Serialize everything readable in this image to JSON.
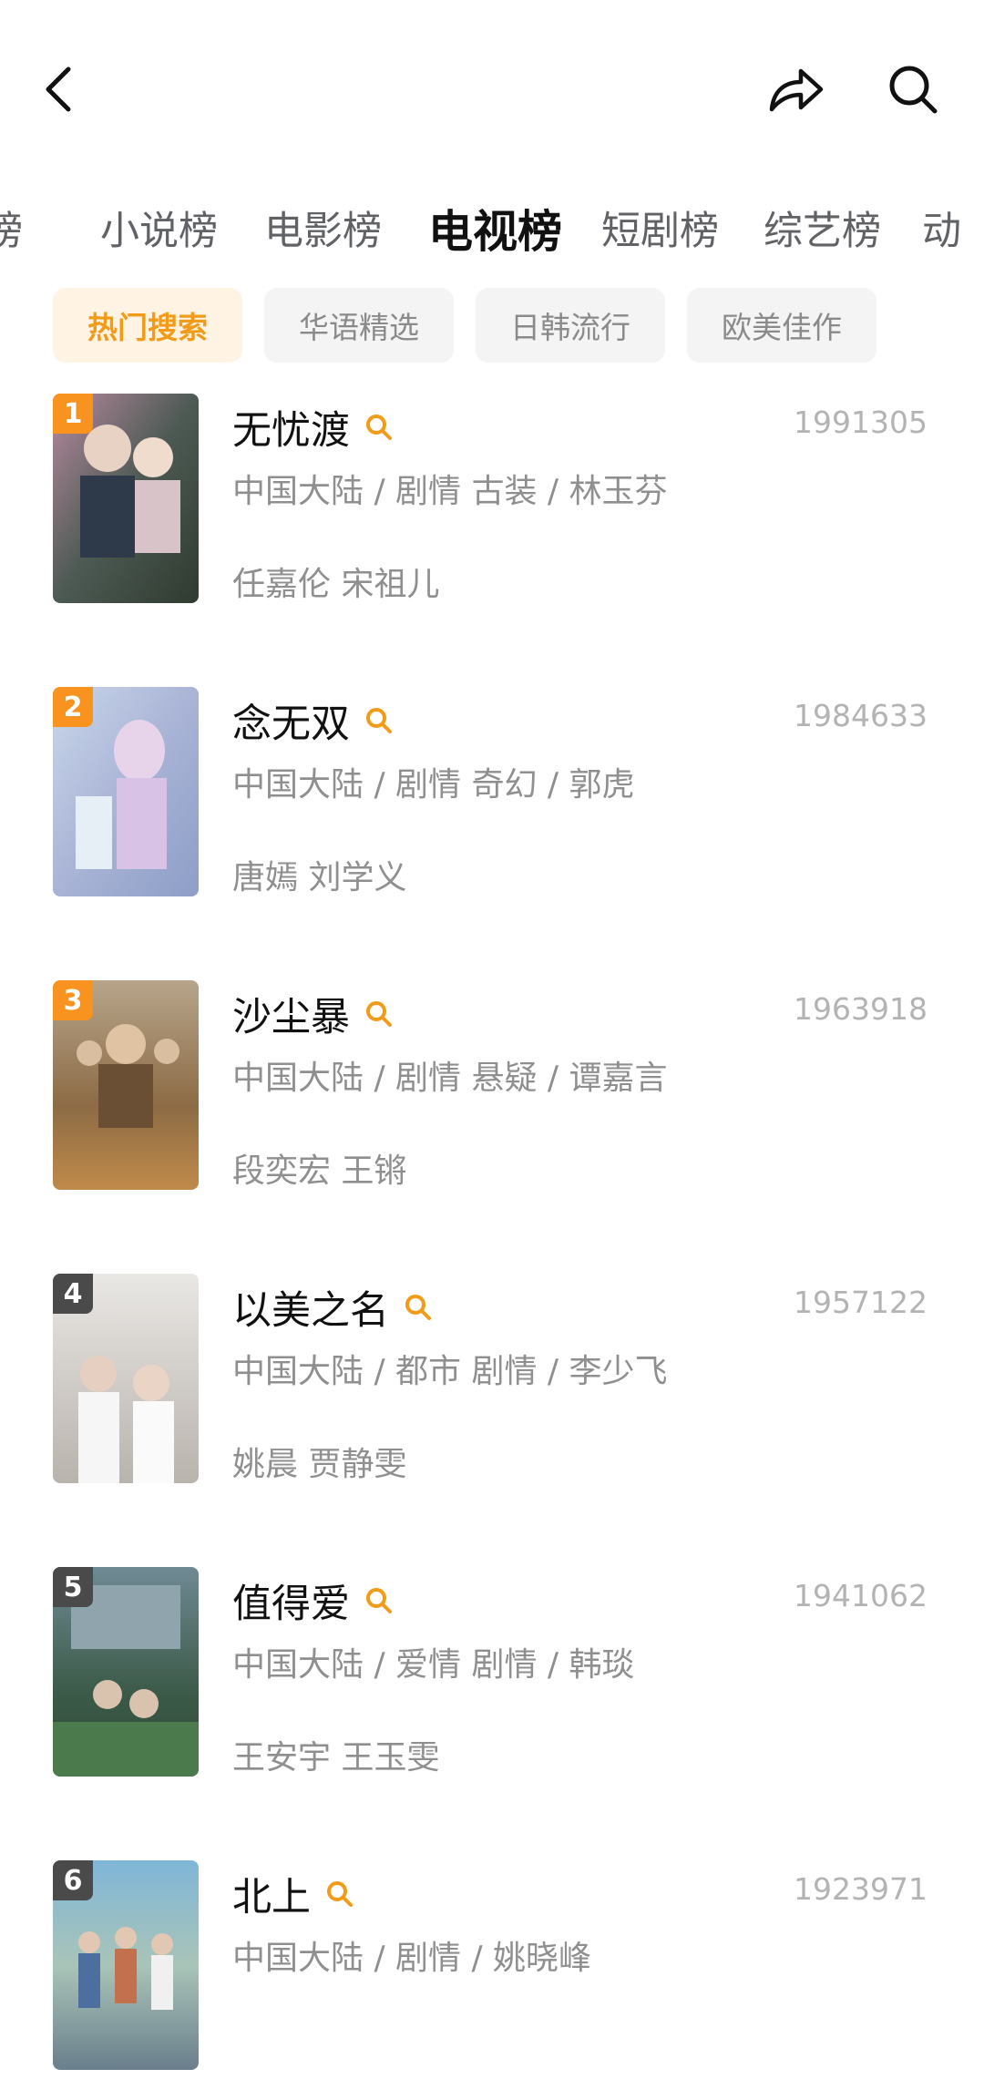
{
  "header": {
    "back_icon": "chevron-left-icon",
    "share_icon": "share-arrow-icon",
    "search_icon": "search-icon"
  },
  "tabs": [
    {
      "label": "榜"
    },
    {
      "label": "小说榜"
    },
    {
      "label": "电影榜"
    },
    {
      "label": "电视榜"
    },
    {
      "label": "短剧榜"
    },
    {
      "label": "综艺榜"
    },
    {
      "label": "动"
    }
  ],
  "active_tab": "电视榜",
  "chips": [
    {
      "label": "热门搜索"
    },
    {
      "label": "华语精选"
    },
    {
      "label": "日韩流行"
    },
    {
      "label": "欧美佳作"
    }
  ],
  "colors": {
    "accent": "#f19b19",
    "rank_top": "#f7931e",
    "rank_other": "#4a4a4a"
  },
  "items": [
    {
      "rank": "1",
      "title": "无忧渡",
      "score": "1991305",
      "meta": "中国大陆 / 剧情 古装 / 林玉芬",
      "cast": "任嘉伦 宋祖儿"
    },
    {
      "rank": "2",
      "title": "念无双",
      "score": "1984633",
      "meta": "中国大陆 / 剧情 奇幻 / 郭虎",
      "cast": "唐嫣 刘学义"
    },
    {
      "rank": "3",
      "title": "沙尘暴",
      "score": "1963918",
      "meta": "中国大陆 / 剧情 悬疑 / 谭嘉言",
      "cast": "段奕宏 王锵"
    },
    {
      "rank": "4",
      "title": "以美之名",
      "score": "1957122",
      "meta": "中国大陆 / 都市 剧情 / 李少飞",
      "cast": "姚晨 贾静雯"
    },
    {
      "rank": "5",
      "title": "值得爱",
      "score": "1941062",
      "meta": "中国大陆 / 爱情 剧情 / 韩琰",
      "cast": "王安宇 王玉雯"
    },
    {
      "rank": "6",
      "title": "北上",
      "score": "1923971",
      "meta": "中国大陆 / 剧情 / 姚晓峰",
      "cast": ""
    }
  ]
}
